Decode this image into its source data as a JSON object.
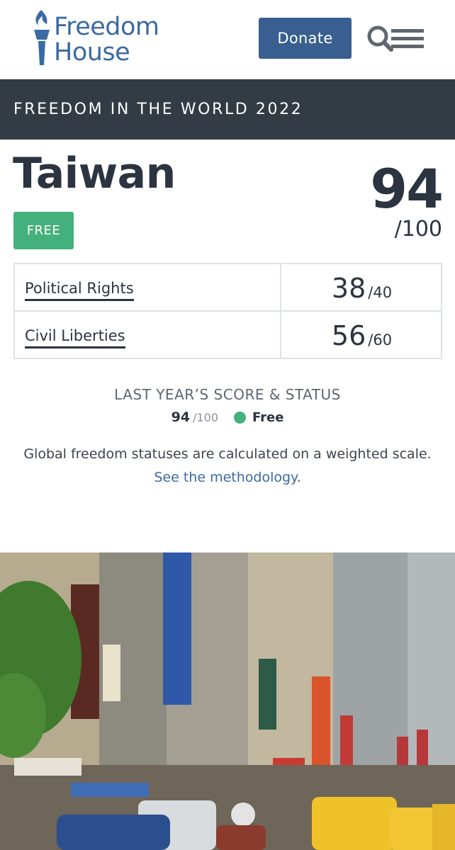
{
  "header": {
    "logo_line1": "Freedom",
    "logo_line2": "House",
    "donate_label": "Donate"
  },
  "banner": {
    "title": "FREEDOM IN THE WORLD 2022"
  },
  "country": {
    "name": "Taiwan",
    "status": "FREE",
    "total_score": "94",
    "total_max": "/100"
  },
  "scores": [
    {
      "label": "Political Rights",
      "score": "38",
      "max": "/40"
    },
    {
      "label": "Civil Liberties",
      "score": "56",
      "max": "/60"
    }
  ],
  "last_year": {
    "title": "LAST YEAR’S SCORE & STATUS",
    "score": "94",
    "max": "/100",
    "status": "Free"
  },
  "note": {
    "text": "Global freedom statuses are calculated on a weighted scale.",
    "link_text": "See the methodology",
    "link_suffix": "."
  },
  "colors": {
    "brand_blue": "#3a6aa3",
    "donate_bg": "#385f8f",
    "banner_bg": "#333b44",
    "free_green": "#44b07b"
  },
  "icons": {
    "logo": "torch-icon",
    "search": "search-icon",
    "menu": "hamburger-menu-icon"
  }
}
